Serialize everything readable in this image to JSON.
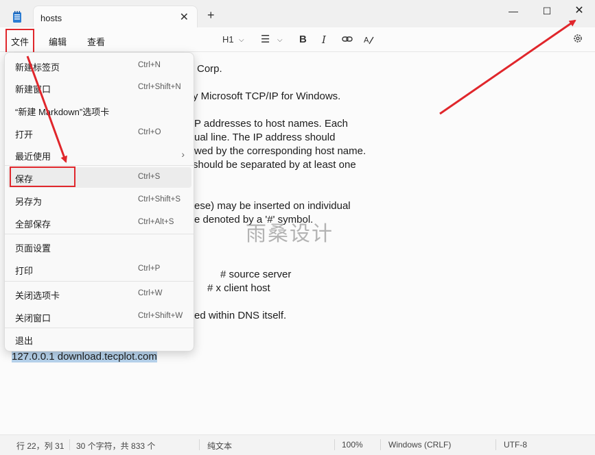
{
  "titlebar": {
    "tab_title": "hosts",
    "tab_close": "✕",
    "new_tab": "+",
    "minimize": "—",
    "maximize": "☐",
    "close": "✕"
  },
  "menubar": {
    "file": "文件",
    "edit": "编辑",
    "view": "查看"
  },
  "toolbar": {
    "heading": "H1",
    "chevron": "⌵",
    "list": "☰",
    "bold": "B",
    "italic": "I",
    "link": "⊖",
    "clear_format": "A̸"
  },
  "editor": {
    "lines": [
      "Corp.",
      "y Microsoft TCP/IP for Windows.",
      "P addresses to host names. Each",
      "ual line. The IP address should",
      "wed by the corresponding host name.",
      "should be separated by at least one",
      "ese) may be inserted on individual",
      "e denoted by a '#' symbol.",
      "# source server",
      "# x client host",
      "ed within DNS itself.",
      "127.0.0.1 download.tecplot.com"
    ]
  },
  "watermark": "雨桑设计",
  "file_menu": {
    "items": [
      {
        "label": "新建标签页",
        "shortcut": "Ctrl+N"
      },
      {
        "label": "新建窗口",
        "shortcut": "Ctrl+Shift+N"
      },
      {
        "label": "“新建 Markdown”选项卡",
        "shortcut": ""
      },
      {
        "label": "打开",
        "shortcut": "Ctrl+O"
      },
      {
        "label": "最近使用",
        "shortcut": "",
        "arrow": "›"
      },
      {
        "label": "保存",
        "shortcut": "Ctrl+S"
      },
      {
        "label": "另存为",
        "shortcut": "Ctrl+Shift+S"
      },
      {
        "label": "全部保存",
        "shortcut": "Ctrl+Alt+S"
      },
      {
        "label": "页面设置",
        "shortcut": ""
      },
      {
        "label": "打印",
        "shortcut": "Ctrl+P"
      },
      {
        "label": "关闭选项卡",
        "shortcut": "Ctrl+W"
      },
      {
        "label": "关闭窗口",
        "shortcut": "Ctrl+Shift+W"
      },
      {
        "label": "退出",
        "shortcut": ""
      }
    ]
  },
  "statusbar": {
    "position": "行 22，列 31",
    "selection": "30 个字符，共 833 个",
    "format": "纯文本",
    "zoom": "100%",
    "line_ending": "Windows (CRLF)",
    "encoding": "UTF-8"
  },
  "colors": {
    "highlight_red": "#e0262b",
    "selection": "#b7d3ec"
  }
}
